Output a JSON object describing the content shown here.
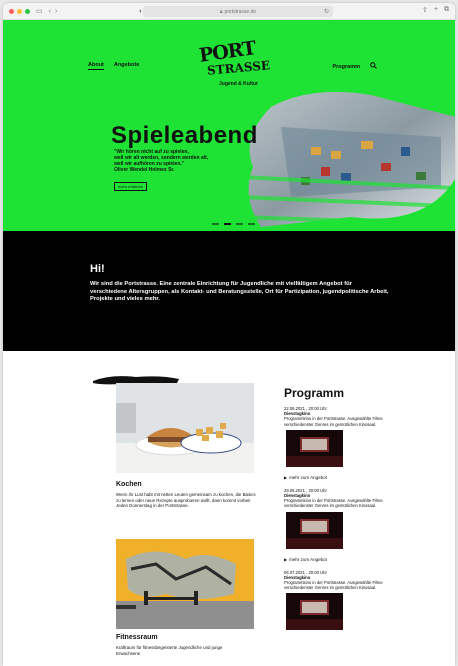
{
  "browser": {
    "url": "portstrasse.de",
    "colors": {
      "close": "#ff5f57",
      "min": "#febc2e",
      "max": "#28c840"
    },
    "icons": [
      "sidebar-icon",
      "back-icon",
      "forward-icon",
      "shield-icon",
      "reload-icon",
      "share-icon",
      "new-tab-icon",
      "tabs-icon"
    ]
  },
  "nav": {
    "left": [
      {
        "label": "About",
        "active": true
      },
      {
        "label": "Angebote"
      }
    ],
    "right_label": "Programm"
  },
  "logo": {
    "line1": "PORT",
    "line2": "STRASSE",
    "sub": "Jugend & Kultur"
  },
  "hero": {
    "title": "Spieleabend",
    "quote_lines": [
      "\"Wir hören nicht auf zu spielen,",
      "weil wir alt werden, sondern werden alt,",
      "weil wir aufhören zu spielen.\"",
      "Oliver Wendel Holmes Sr."
    ],
    "button": "mehr erfahren",
    "accent": "#1ee335"
  },
  "intro": {
    "heading": "Hi!",
    "text": "Wir sind die Portstrasse. Eine zentrale Einrichtung für Jugendliche mit vielfältigem Angebot für verschiedene Altersgruppen, als Kontakt- und Beratungsstelle, Ort für Partizipation, jugendpolitische Arbeit, Projekte und vieles mehr."
  },
  "cards": [
    {
      "title": "Kochen",
      "text": "Wenn ihr Lust habt mit netten Leuten gemeinsam zu kochen, die Basics zu lernen oder neue Rezepte ausprobieren wollt, dann kommt vorbei! Jeden Donnerstag in der Portstrasse."
    },
    {
      "title": "Fitnessraum",
      "text": "Kraftraum für fitnessbegeisterte Jugendliche und junge Erwachsene"
    }
  ],
  "program": {
    "heading": "Programm",
    "link_label": "mehr zum Angebot",
    "events": [
      {
        "date": "22.06.2021 , 20:00 Uhr",
        "title": "Dienstagkino",
        "desc": "Programmkino in der Portstrasse. Ausgewählte Filme verschiedenster Genres im gemütlichen Kinosaal."
      },
      {
        "date": "29.06.2021 , 20:00 Uhr",
        "title": "Dienstagkino",
        "desc": "Programmkino in der Portstrasse. Ausgewählte Filme verschiedenster Genres im gemütlichen Kinosaal."
      },
      {
        "date": "06.07.2021 , 20:00 Uhr",
        "title": "Dienstagkino",
        "desc": "Programmkino in der Portstrasse. Ausgewählte Filme verschiedenster Genres im gemütlichen Kinosaal."
      }
    ]
  }
}
